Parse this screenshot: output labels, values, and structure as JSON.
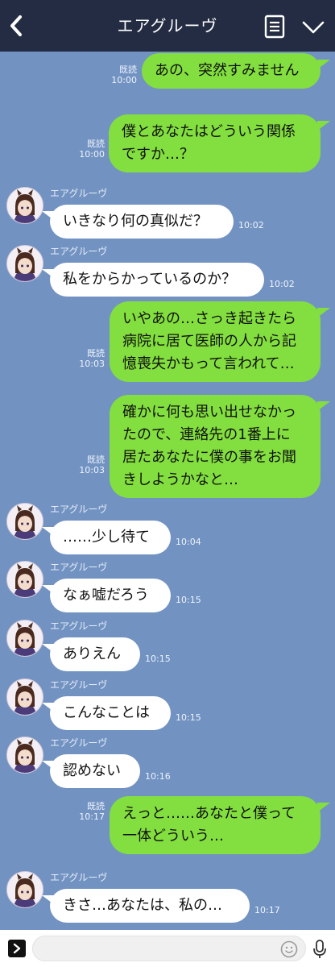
{
  "header": {
    "title": "エアグルーヴ"
  },
  "contact": {
    "name": "エアグルーヴ"
  },
  "status": {
    "read": "既読"
  },
  "messages": [
    {
      "side": "me",
      "text": "あの、突然すみません",
      "time": "10:00"
    },
    {
      "side": "me",
      "text": "僕とあなたはどういう関係\nですか…？",
      "time": "10:00"
    },
    {
      "side": "them",
      "text": "いきなり何の真似だ？",
      "time": "10:02"
    },
    {
      "side": "them",
      "text": "私をからかっているのか？",
      "time": "10:02"
    },
    {
      "side": "me",
      "text": "いやあの…さっき起きたら\n病院に居て医師の人から記\n憶喪失かもって言われて…",
      "time": "10:03"
    },
    {
      "side": "me",
      "text": "確かに何も思い出せなかっ\nたので、連絡先の1番上に\n居たあなたに僕の事をお聞\nきしようかなと…",
      "time": "10:03"
    },
    {
      "side": "them",
      "text": "……少し待て",
      "time": "10:04"
    },
    {
      "side": "them",
      "text": "なぁ嘘だろう",
      "time": "10:15"
    },
    {
      "side": "them",
      "text": "ありえん",
      "time": "10:15"
    },
    {
      "side": "them",
      "text": "こんなことは",
      "time": "10:15"
    },
    {
      "side": "them",
      "text": "認めない",
      "time": "10:16"
    },
    {
      "side": "me",
      "text": "えっと……あなたと僕って\n一体どういう…",
      "time": "10:17"
    },
    {
      "side": "them",
      "text": "きさ…あなたは、私の…",
      "time": "10:17"
    }
  ],
  "icons": {
    "back": "chevron-left",
    "note": "note",
    "menu": "chevron-down",
    "expand": "chevron-right",
    "emoji": "smiley",
    "mic": "microphone"
  },
  "colors": {
    "header": "#232c42",
    "background": "#7293c2",
    "me_bubble": "#83df3f",
    "them_bubble": "#ffffff"
  }
}
